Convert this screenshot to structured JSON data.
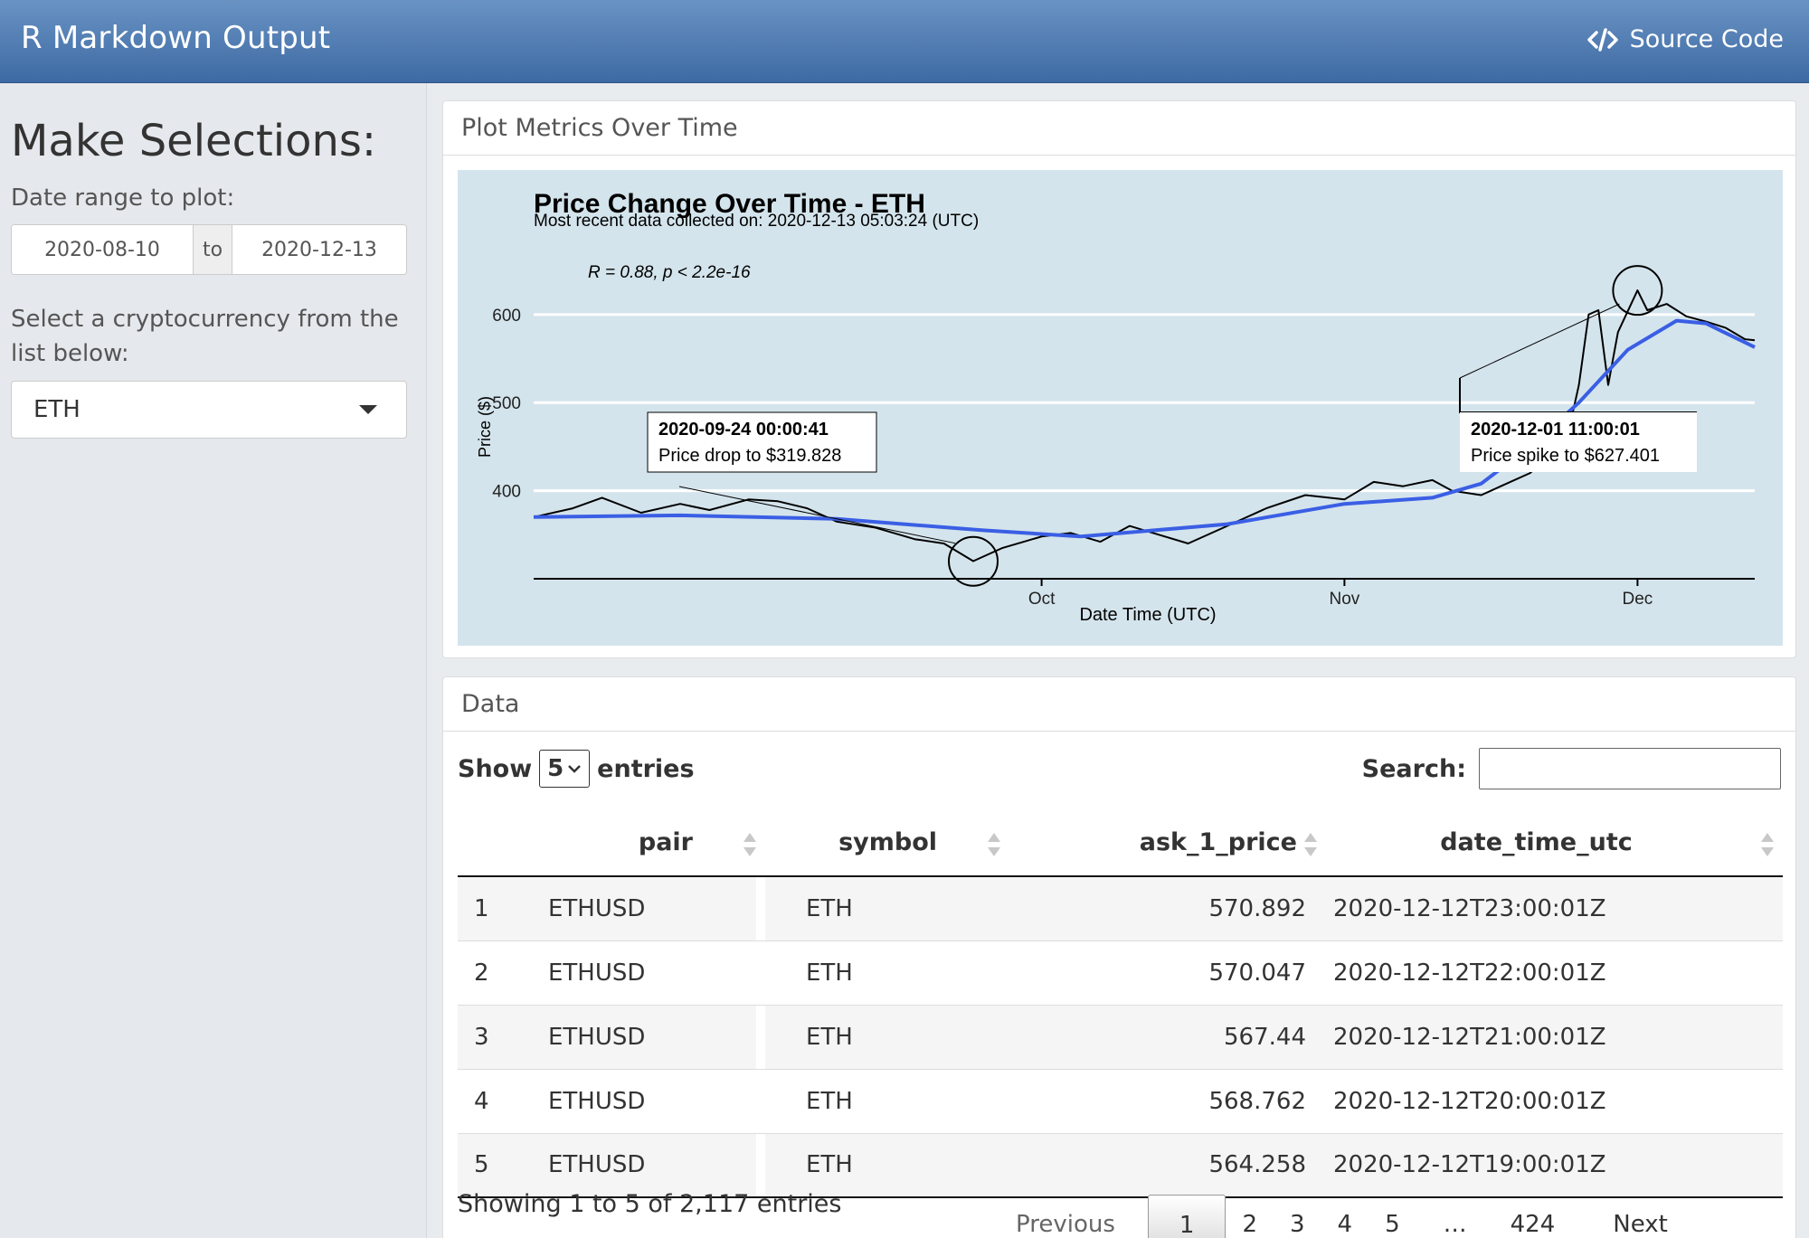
{
  "navbar": {
    "title": "R Markdown Output",
    "source_label": "Source Code"
  },
  "sidebar": {
    "heading": "Make Selections:",
    "date_label": "Date range to plot:",
    "date_start": "2020-08-10",
    "date_sep": "to",
    "date_end": "2020-12-13",
    "select_label": "Select a cryptocurrency from the list below:",
    "selected_currency": "ETH"
  },
  "plot_panel": {
    "title": "Plot Metrics Over Time"
  },
  "chart_data": {
    "type": "line",
    "title": "Price Change Over Time - ETH",
    "subtitle": "Most recent data collected on: 2020-12-13 05:03:24 (UTC)",
    "xlabel": "Date Time (UTC)",
    "ylabel": "Price ($)",
    "x_ticks": [
      "Oct",
      "Nov",
      "Dec"
    ],
    "x_tick_dates": [
      "2020-10-01",
      "2020-11-01",
      "2020-12-01"
    ],
    "xlim": [
      "2020-08-10",
      "2020-12-13"
    ],
    "y_ticks": [
      400,
      500,
      600
    ],
    "ylim": [
      300,
      645
    ],
    "grid": true,
    "stat_annotation": "R = 0.88, p < 2.2e-16",
    "annotations": [
      {
        "date": "2020-09-24",
        "value": 319.828,
        "line1": "2020-09-24 00:00:41",
        "line2": "Price drop to $319.828"
      },
      {
        "date": "2020-12-01",
        "value": 627.401,
        "line1": "2020-12-01 11:00:01",
        "line2": "Price spike to $627.401"
      }
    ],
    "series": [
      {
        "color": "#000000",
        "points": [
          [
            "2020-08-10",
            370
          ],
          [
            "2020-08-14",
            380
          ],
          [
            "2020-08-17",
            392
          ],
          [
            "2020-08-21",
            375
          ],
          [
            "2020-08-25",
            385
          ],
          [
            "2020-08-28",
            378
          ],
          [
            "2020-09-01",
            390
          ],
          [
            "2020-09-04",
            388
          ],
          [
            "2020-09-07",
            380
          ],
          [
            "2020-09-10",
            365
          ],
          [
            "2020-09-14",
            358
          ],
          [
            "2020-09-18",
            345
          ],
          [
            "2020-09-21",
            340
          ],
          [
            "2020-09-24",
            320
          ],
          [
            "2020-09-27",
            335
          ],
          [
            "2020-10-01",
            348
          ],
          [
            "2020-10-04",
            352
          ],
          [
            "2020-10-07",
            342
          ],
          [
            "2020-10-10",
            360
          ],
          [
            "2020-10-13",
            350
          ],
          [
            "2020-10-16",
            340
          ],
          [
            "2020-10-20",
            360
          ],
          [
            "2020-10-24",
            380
          ],
          [
            "2020-10-28",
            395
          ],
          [
            "2020-11-01",
            390
          ],
          [
            "2020-11-04",
            410
          ],
          [
            "2020-11-07",
            405
          ],
          [
            "2020-11-10",
            412
          ],
          [
            "2020-11-12",
            400
          ],
          [
            "2020-11-15",
            395
          ],
          [
            "2020-11-17",
            405
          ],
          [
            "2020-11-20",
            420
          ],
          [
            "2020-11-22",
            440
          ],
          [
            "2020-11-24",
            470
          ],
          [
            "2020-11-25",
            520
          ],
          [
            "2020-11-26",
            600
          ],
          [
            "2020-11-27",
            605
          ],
          [
            "2020-11-28",
            520
          ],
          [
            "2020-11-29",
            580
          ],
          [
            "2020-12-01",
            627.401
          ],
          [
            "2020-12-02",
            605
          ],
          [
            "2020-12-04",
            612
          ],
          [
            "2020-12-06",
            598
          ],
          [
            "2020-12-08",
            592
          ],
          [
            "2020-12-10",
            585
          ],
          [
            "2020-12-12",
            572
          ],
          [
            "2020-12-13",
            570.892
          ]
        ]
      },
      {
        "color": "#3a5fe5",
        "points": [
          [
            "2020-08-10",
            370
          ],
          [
            "2020-08-25",
            372
          ],
          [
            "2020-09-10",
            368
          ],
          [
            "2020-09-25",
            355
          ],
          [
            "2020-10-05",
            348
          ],
          [
            "2020-10-20",
            362
          ],
          [
            "2020-11-01",
            385
          ],
          [
            "2020-11-10",
            392
          ],
          [
            "2020-11-15",
            408
          ],
          [
            "2020-11-20",
            450
          ],
          [
            "2020-11-25",
            500
          ],
          [
            "2020-11-30",
            560
          ],
          [
            "2020-12-05",
            593
          ],
          [
            "2020-12-08",
            590
          ],
          [
            "2020-12-13",
            563
          ]
        ]
      }
    ]
  },
  "data_panel": {
    "title": "Data",
    "show_label": "Show",
    "page_length": "5",
    "entries_label": "entries",
    "search_label": "Search:",
    "columns": [
      "",
      "pair",
      "symbol",
      "ask_1_price",
      "date_time_utc"
    ],
    "rows": [
      [
        "1",
        "ETHUSD",
        "ETH",
        "570.892",
        "2020-12-12T23:00:01Z"
      ],
      [
        "2",
        "ETHUSD",
        "ETH",
        "570.047",
        "2020-12-12T22:00:01Z"
      ],
      [
        "3",
        "ETHUSD",
        "ETH",
        "567.44",
        "2020-12-12T21:00:01Z"
      ],
      [
        "4",
        "ETHUSD",
        "ETH",
        "568.762",
        "2020-12-12T20:00:01Z"
      ],
      [
        "5",
        "ETHUSD",
        "ETH",
        "564.258",
        "2020-12-12T19:00:01Z"
      ]
    ],
    "info": "Showing 1 to 5 of 2,117 entries",
    "pagination": [
      "Previous",
      "1",
      "2",
      "3",
      "4",
      "5",
      "…",
      "424",
      "Next"
    ]
  }
}
